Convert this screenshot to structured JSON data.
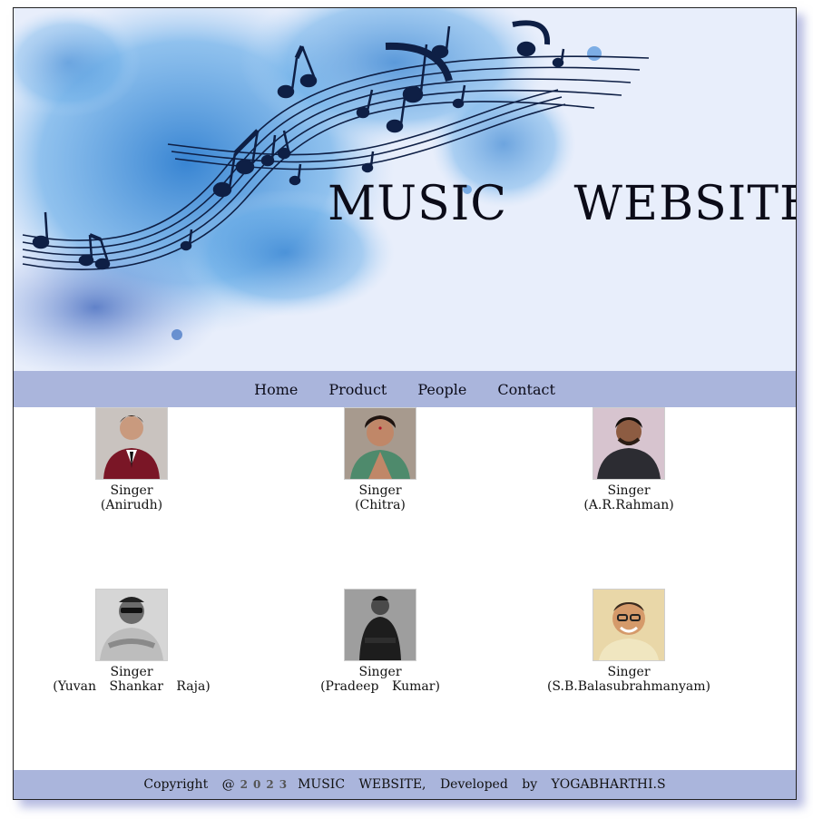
{
  "header": {
    "title": "MUSIC WEBSITE"
  },
  "nav": {
    "items": [
      "Home",
      "Product",
      "People",
      "Contact"
    ]
  },
  "people": [
    {
      "role": "Singer",
      "name": "(Anirudh)",
      "icon": "anirudh-photo"
    },
    {
      "role": "Singer",
      "name": "(Chitra)",
      "icon": "chitra-photo"
    },
    {
      "role": "Singer",
      "name": "(A.R.Rahman)",
      "icon": "arrahman-photo"
    },
    {
      "role": "Singer",
      "name": "(Yuvan Shankar Raja)",
      "icon": "yuvan-photo"
    },
    {
      "role": "Singer",
      "name": "(Pradeep Kumar)",
      "icon": "pradeep-photo"
    },
    {
      "role": "Singer",
      "name": "(S.B.Balasubrahmanyam)",
      "icon": "spb-photo"
    }
  ],
  "footer": {
    "prefix": "Copyright @",
    "year": "2023",
    "suffix": "MUSIC WEBSITE, Developed by YOGABHARTHI.S"
  },
  "colors": {
    "nav_bg": "#aab5dc",
    "banner_blue": "#3c8fd8",
    "ink": "#0b0b18"
  }
}
